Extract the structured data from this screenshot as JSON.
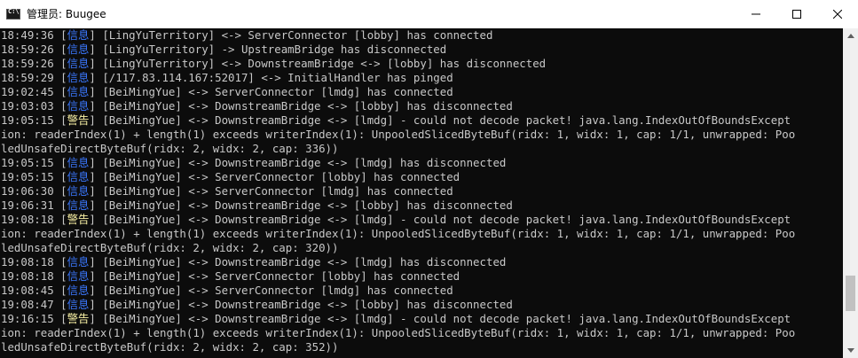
{
  "window": {
    "title": "管理员:  Buugee",
    "icon": "console-icon",
    "controls": [
      "minimize-icon",
      "maximize-icon",
      "close-icon"
    ]
  },
  "scrollbar": {
    "position_fraction": 0.88
  },
  "colors": {
    "console_bg": "#0c0c0c",
    "text": "#c8c8c8",
    "info_level": "#3b78ff",
    "warn_level": "#f9f1a5"
  },
  "log": [
    {
      "kind": "entry",
      "time": "18:49:36",
      "level": "信息",
      "level_type": "info",
      "msg": "[LingYuTerritory] <-> ServerConnector [lobby] has connected"
    },
    {
      "kind": "entry",
      "time": "18:59:26",
      "level": "信息",
      "level_type": "info",
      "msg": "[LingYuTerritory] -> UpstreamBridge has disconnected"
    },
    {
      "kind": "entry",
      "time": "18:59:26",
      "level": "信息",
      "level_type": "info",
      "msg": "[LingYuTerritory] <-> DownstreamBridge <-> [lobby] has disconnected"
    },
    {
      "kind": "entry",
      "time": "18:59:29",
      "level": "信息",
      "level_type": "info",
      "msg": "[/117.83.114.167:52017] <-> InitialHandler has pinged"
    },
    {
      "kind": "entry",
      "time": "19:02:45",
      "level": "信息",
      "level_type": "info",
      "msg": "[BeiMingYue] <-> ServerConnector [lmdg] has connected"
    },
    {
      "kind": "entry",
      "time": "19:03:03",
      "level": "信息",
      "level_type": "info",
      "msg": "[BeiMingYue] <-> DownstreamBridge <-> [lobby] has disconnected"
    },
    {
      "kind": "entry",
      "time": "19:05:15",
      "level": "警告",
      "level_type": "warn",
      "msg": "[BeiMingYue] <-> DownstreamBridge <-> [lmdg] - could not decode packet! java.lang.IndexOutOfBoundsExcept"
    },
    {
      "kind": "cont",
      "text": "ion: readerIndex(1) + length(1) exceeds writerIndex(1): UnpooledSlicedByteBuf(ridx: 1, widx: 1, cap: 1/1, unwrapped: Poo"
    },
    {
      "kind": "cont",
      "text": "ledUnsafeDirectByteBuf(ridx: 2, widx: 2, cap: 336))"
    },
    {
      "kind": "entry",
      "time": "19:05:15",
      "level": "信息",
      "level_type": "info",
      "msg": "[BeiMingYue] <-> DownstreamBridge <-> [lmdg] has disconnected"
    },
    {
      "kind": "entry",
      "time": "19:05:15",
      "level": "信息",
      "level_type": "info",
      "msg": "[BeiMingYue] <-> ServerConnector [lobby] has connected"
    },
    {
      "kind": "entry",
      "time": "19:06:30",
      "level": "信息",
      "level_type": "info",
      "msg": "[BeiMingYue] <-> ServerConnector [lmdg] has connected"
    },
    {
      "kind": "entry",
      "time": "19:06:31",
      "level": "信息",
      "level_type": "info",
      "msg": "[BeiMingYue] <-> DownstreamBridge <-> [lobby] has disconnected"
    },
    {
      "kind": "entry",
      "time": "19:08:18",
      "level": "警告",
      "level_type": "warn",
      "msg": "[BeiMingYue] <-> DownstreamBridge <-> [lmdg] - could not decode packet! java.lang.IndexOutOfBoundsExcept"
    },
    {
      "kind": "cont",
      "text": "ion: readerIndex(1) + length(1) exceeds writerIndex(1): UnpooledSlicedByteBuf(ridx: 1, widx: 1, cap: 1/1, unwrapped: Poo"
    },
    {
      "kind": "cont",
      "text": "ledUnsafeDirectByteBuf(ridx: 2, widx: 2, cap: 320))"
    },
    {
      "kind": "entry",
      "time": "19:08:18",
      "level": "信息",
      "level_type": "info",
      "msg": "[BeiMingYue] <-> DownstreamBridge <-> [lmdg] has disconnected"
    },
    {
      "kind": "entry",
      "time": "19:08:18",
      "level": "信息",
      "level_type": "info",
      "msg": "[BeiMingYue] <-> ServerConnector [lobby] has connected"
    },
    {
      "kind": "entry",
      "time": "19:08:45",
      "level": "信息",
      "level_type": "info",
      "msg": "[BeiMingYue] <-> ServerConnector [lmdg] has connected"
    },
    {
      "kind": "entry",
      "time": "19:08:47",
      "level": "信息",
      "level_type": "info",
      "msg": "[BeiMingYue] <-> DownstreamBridge <-> [lobby] has disconnected"
    },
    {
      "kind": "entry",
      "time": "19:16:15",
      "level": "警告",
      "level_type": "warn",
      "msg": "[BeiMingYue] <-> DownstreamBridge <-> [lmdg] - could not decode packet! java.lang.IndexOutOfBoundsExcept"
    },
    {
      "kind": "cont",
      "text": "ion: readerIndex(1) + length(1) exceeds writerIndex(1): UnpooledSlicedByteBuf(ridx: 1, widx: 1, cap: 1/1, unwrapped: Poo"
    },
    {
      "kind": "cont",
      "text": "ledUnsafeDirectByteBuf(ridx: 2, widx: 2, cap: 352))"
    }
  ]
}
